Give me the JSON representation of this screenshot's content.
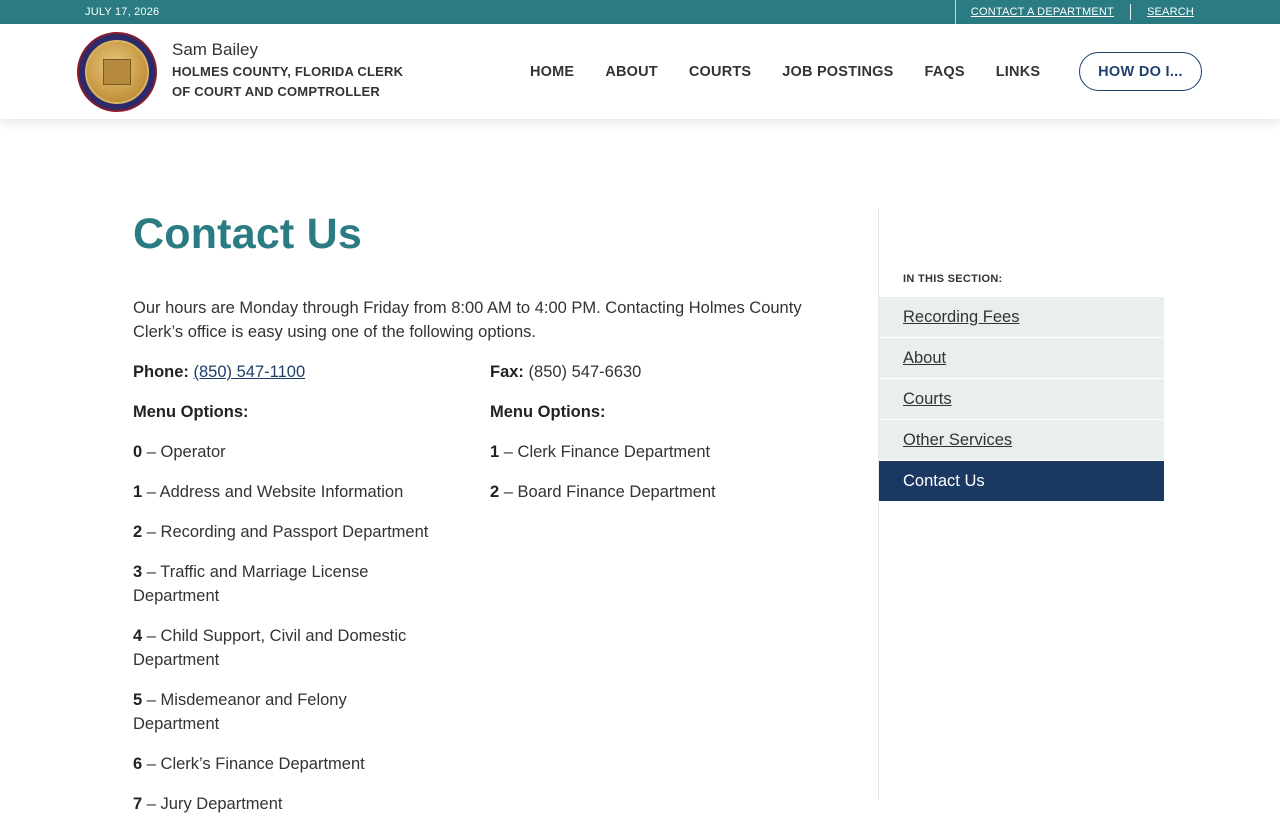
{
  "topbar": {
    "date": "JULY 17, 2026",
    "contact_link": "CONTACT A DEPARTMENT",
    "search_link": "SEARCH"
  },
  "header": {
    "seal_icon": "county-seal-icon",
    "clerk_name": "Sam Bailey",
    "org_line1": "HOLMES COUNTY, FLORIDA CLERK",
    "org_line2": "OF COURT AND COMPTROLLER",
    "nav": [
      "HOME",
      "ABOUT",
      "COURTS",
      "JOB POSTINGS",
      "FAQS",
      "LINKS"
    ],
    "cta": "HOW DO I..."
  },
  "main": {
    "title": "Contact Us",
    "intro": "Our hours are Monday through Friday from 8:00 AM to 4:00 PM. Contacting Holmes County Clerk’s office is easy using one of the following options.",
    "phone": {
      "label": "Phone:",
      "value": "(850) 547-1100",
      "menu_label": "Menu Options:",
      "options": [
        {
          "num": "0",
          "text": " – Operator"
        },
        {
          "num": "1",
          "text": " – Address and Website Information"
        },
        {
          "num": "2",
          "text": " – Recording and Passport Department"
        },
        {
          "num": "3",
          "text": " – Traffic and Marriage License Department"
        },
        {
          "num": "4",
          "text": " – Child Support, Civil and Domestic Department"
        },
        {
          "num": "5",
          "text": " – Misdemeanor and Felony Department"
        },
        {
          "num": "6",
          "text": " – Clerk’s Finance Department"
        },
        {
          "num": "7",
          "text": " – Jury Department"
        }
      ]
    },
    "fax": {
      "label": "Fax:",
      "value": " (850) 547-6630",
      "menu_label": "Menu Options:",
      "options": [
        {
          "num": "1",
          "text": " – Clerk Finance Department"
        },
        {
          "num": "2",
          "text": " – Board Finance Department"
        }
      ]
    }
  },
  "sidebar": {
    "label": "IN THIS SECTION:",
    "items": [
      "Recording Fees",
      "About",
      "Courts",
      "Other Services",
      "Contact Us"
    ]
  },
  "colors": {
    "teal": "#2a7b82",
    "navy": "#1b3863",
    "sidebar_bg": "#e9eeef"
  }
}
